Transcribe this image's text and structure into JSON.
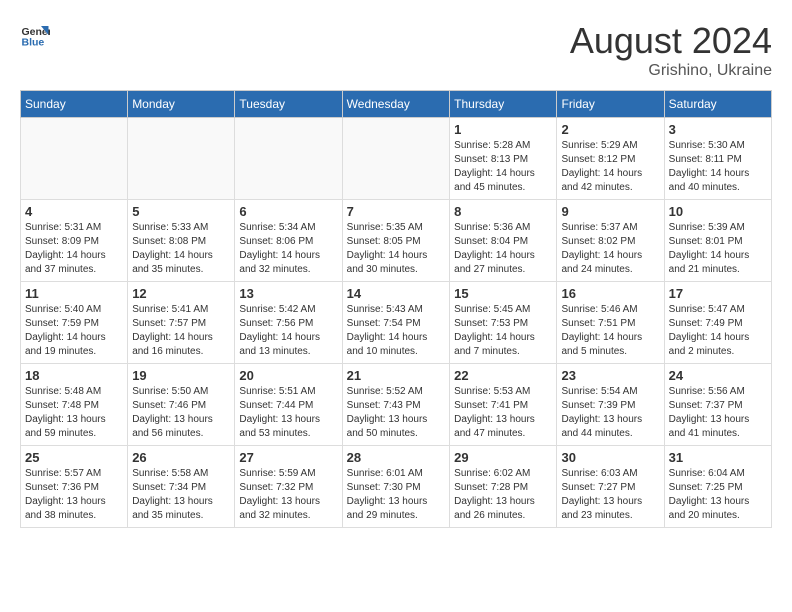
{
  "header": {
    "logo_general": "General",
    "logo_blue": "Blue",
    "month_year": "August 2024",
    "location": "Grishino, Ukraine"
  },
  "days_of_week": [
    "Sunday",
    "Monday",
    "Tuesday",
    "Wednesday",
    "Thursday",
    "Friday",
    "Saturday"
  ],
  "weeks": [
    [
      {
        "day": "",
        "info": ""
      },
      {
        "day": "",
        "info": ""
      },
      {
        "day": "",
        "info": ""
      },
      {
        "day": "",
        "info": ""
      },
      {
        "day": "1",
        "info": "Sunrise: 5:28 AM\nSunset: 8:13 PM\nDaylight: 14 hours\nand 45 minutes."
      },
      {
        "day": "2",
        "info": "Sunrise: 5:29 AM\nSunset: 8:12 PM\nDaylight: 14 hours\nand 42 minutes."
      },
      {
        "day": "3",
        "info": "Sunrise: 5:30 AM\nSunset: 8:11 PM\nDaylight: 14 hours\nand 40 minutes."
      }
    ],
    [
      {
        "day": "4",
        "info": "Sunrise: 5:31 AM\nSunset: 8:09 PM\nDaylight: 14 hours\nand 37 minutes."
      },
      {
        "day": "5",
        "info": "Sunrise: 5:33 AM\nSunset: 8:08 PM\nDaylight: 14 hours\nand 35 minutes."
      },
      {
        "day": "6",
        "info": "Sunrise: 5:34 AM\nSunset: 8:06 PM\nDaylight: 14 hours\nand 32 minutes."
      },
      {
        "day": "7",
        "info": "Sunrise: 5:35 AM\nSunset: 8:05 PM\nDaylight: 14 hours\nand 30 minutes."
      },
      {
        "day": "8",
        "info": "Sunrise: 5:36 AM\nSunset: 8:04 PM\nDaylight: 14 hours\nand 27 minutes."
      },
      {
        "day": "9",
        "info": "Sunrise: 5:37 AM\nSunset: 8:02 PM\nDaylight: 14 hours\nand 24 minutes."
      },
      {
        "day": "10",
        "info": "Sunrise: 5:39 AM\nSunset: 8:01 PM\nDaylight: 14 hours\nand 21 minutes."
      }
    ],
    [
      {
        "day": "11",
        "info": "Sunrise: 5:40 AM\nSunset: 7:59 PM\nDaylight: 14 hours\nand 19 minutes."
      },
      {
        "day": "12",
        "info": "Sunrise: 5:41 AM\nSunset: 7:57 PM\nDaylight: 14 hours\nand 16 minutes."
      },
      {
        "day": "13",
        "info": "Sunrise: 5:42 AM\nSunset: 7:56 PM\nDaylight: 14 hours\nand 13 minutes."
      },
      {
        "day": "14",
        "info": "Sunrise: 5:43 AM\nSunset: 7:54 PM\nDaylight: 14 hours\nand 10 minutes."
      },
      {
        "day": "15",
        "info": "Sunrise: 5:45 AM\nSunset: 7:53 PM\nDaylight: 14 hours\nand 7 minutes."
      },
      {
        "day": "16",
        "info": "Sunrise: 5:46 AM\nSunset: 7:51 PM\nDaylight: 14 hours\nand 5 minutes."
      },
      {
        "day": "17",
        "info": "Sunrise: 5:47 AM\nSunset: 7:49 PM\nDaylight: 14 hours\nand 2 minutes."
      }
    ],
    [
      {
        "day": "18",
        "info": "Sunrise: 5:48 AM\nSunset: 7:48 PM\nDaylight: 13 hours\nand 59 minutes."
      },
      {
        "day": "19",
        "info": "Sunrise: 5:50 AM\nSunset: 7:46 PM\nDaylight: 13 hours\nand 56 minutes."
      },
      {
        "day": "20",
        "info": "Sunrise: 5:51 AM\nSunset: 7:44 PM\nDaylight: 13 hours\nand 53 minutes."
      },
      {
        "day": "21",
        "info": "Sunrise: 5:52 AM\nSunset: 7:43 PM\nDaylight: 13 hours\nand 50 minutes."
      },
      {
        "day": "22",
        "info": "Sunrise: 5:53 AM\nSunset: 7:41 PM\nDaylight: 13 hours\nand 47 minutes."
      },
      {
        "day": "23",
        "info": "Sunrise: 5:54 AM\nSunset: 7:39 PM\nDaylight: 13 hours\nand 44 minutes."
      },
      {
        "day": "24",
        "info": "Sunrise: 5:56 AM\nSunset: 7:37 PM\nDaylight: 13 hours\nand 41 minutes."
      }
    ],
    [
      {
        "day": "25",
        "info": "Sunrise: 5:57 AM\nSunset: 7:36 PM\nDaylight: 13 hours\nand 38 minutes."
      },
      {
        "day": "26",
        "info": "Sunrise: 5:58 AM\nSunset: 7:34 PM\nDaylight: 13 hours\nand 35 minutes."
      },
      {
        "day": "27",
        "info": "Sunrise: 5:59 AM\nSunset: 7:32 PM\nDaylight: 13 hours\nand 32 minutes."
      },
      {
        "day": "28",
        "info": "Sunrise: 6:01 AM\nSunset: 7:30 PM\nDaylight: 13 hours\nand 29 minutes."
      },
      {
        "day": "29",
        "info": "Sunrise: 6:02 AM\nSunset: 7:28 PM\nDaylight: 13 hours\nand 26 minutes."
      },
      {
        "day": "30",
        "info": "Sunrise: 6:03 AM\nSunset: 7:27 PM\nDaylight: 13 hours\nand 23 minutes."
      },
      {
        "day": "31",
        "info": "Sunrise: 6:04 AM\nSunset: 7:25 PM\nDaylight: 13 hours\nand 20 minutes."
      }
    ]
  ]
}
